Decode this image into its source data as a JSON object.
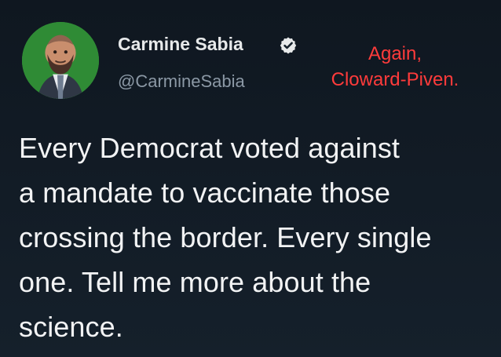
{
  "profile": {
    "display_name": "Carmine Sabia",
    "handle": "@CarmineSabia",
    "avatar_icon": "profile-photo-icon",
    "verified_icon": "verified-badge-icon"
  },
  "annotation": {
    "lines": [
      "Again,",
      "Cloward-Piven."
    ],
    "color": "#ff3b3b"
  },
  "tweet": {
    "lines": [
      "Every Democrat voted against",
      "a mandate to vaccinate those",
      "crossing the border. Every single",
      "one. Tell me more about the",
      "science."
    ]
  },
  "colors": {
    "background": "#15202b",
    "text": "#f2f3f4",
    "muted": "#8b98a5",
    "avatar_background": "#2f8b35"
  }
}
